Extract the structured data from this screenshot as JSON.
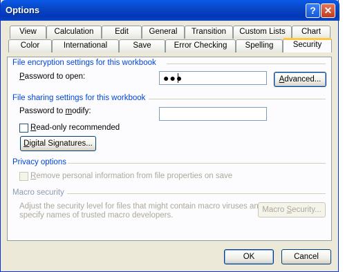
{
  "window": {
    "title": "Options",
    "help_symbol": "?",
    "close_symbol": "✕"
  },
  "tabs_row1": [
    "View",
    "Calculation",
    "Edit",
    "General",
    "Transition",
    "Custom Lists",
    "Chart"
  ],
  "tabs_row2": [
    "Color",
    "International",
    "Save",
    "Error Checking",
    "Spelling",
    "Security"
  ],
  "active_tab": "Security",
  "encryption": {
    "section": "File encryption settings for this workbook",
    "password_label": "Password to open:",
    "password_value": "●●●",
    "advanced_button": "Advanced..."
  },
  "sharing": {
    "section": "File sharing settings for this workbook",
    "modify_label": "Password to modify:",
    "modify_value": "",
    "readonly_label": "Read-only recommended",
    "readonly_checked": false,
    "digital_signatures_button": "Digital Signatures..."
  },
  "privacy": {
    "section": "Privacy options",
    "remove_info_label": "Remove personal information from file properties on save",
    "remove_info_checked": false
  },
  "macro": {
    "section": "Macro security",
    "description_line1": "Adjust the security level for files that might contain macro viruses and",
    "description_line2": "specify names of trusted macro developers.",
    "button": "Macro Security..."
  },
  "footer": {
    "ok": "OK",
    "cancel": "Cancel"
  },
  "colors": {
    "title_bar": "#0a5ae8",
    "section_heading": "#0046d5",
    "dialog_bg": "#ece9d8",
    "active_tab_highlight": "#ffc83c"
  }
}
